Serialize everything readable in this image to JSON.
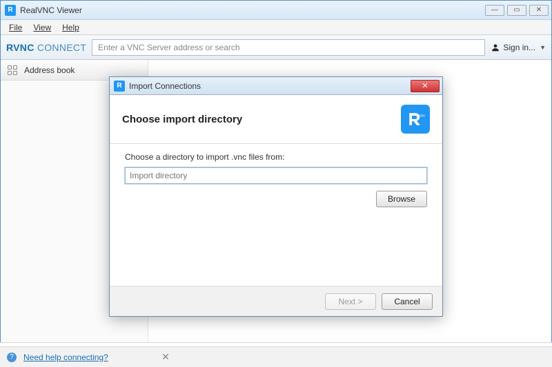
{
  "window": {
    "title": "RealVNC Viewer",
    "controls": {
      "min": "—",
      "max": "▭",
      "close": "✕"
    }
  },
  "menu": {
    "file": "File",
    "view": "View",
    "help": "Help"
  },
  "toolbar": {
    "brand_a": "RVNC",
    "brand_b": "CONNECT",
    "search_placeholder": "Enter a VNC Server address or search",
    "signin": "Sign in..."
  },
  "sidebar": {
    "address_book": "Address book"
  },
  "status": {
    "help": "Need help connecting?",
    "close": "✕"
  },
  "dialog": {
    "title": "Import Connections",
    "heading": "Choose import directory",
    "label": "Choose a directory to import .vnc files from:",
    "placeholder": "Import directory",
    "browse": "Browse",
    "next": "Next  >",
    "cancel": "Cancel",
    "close": "✕"
  }
}
